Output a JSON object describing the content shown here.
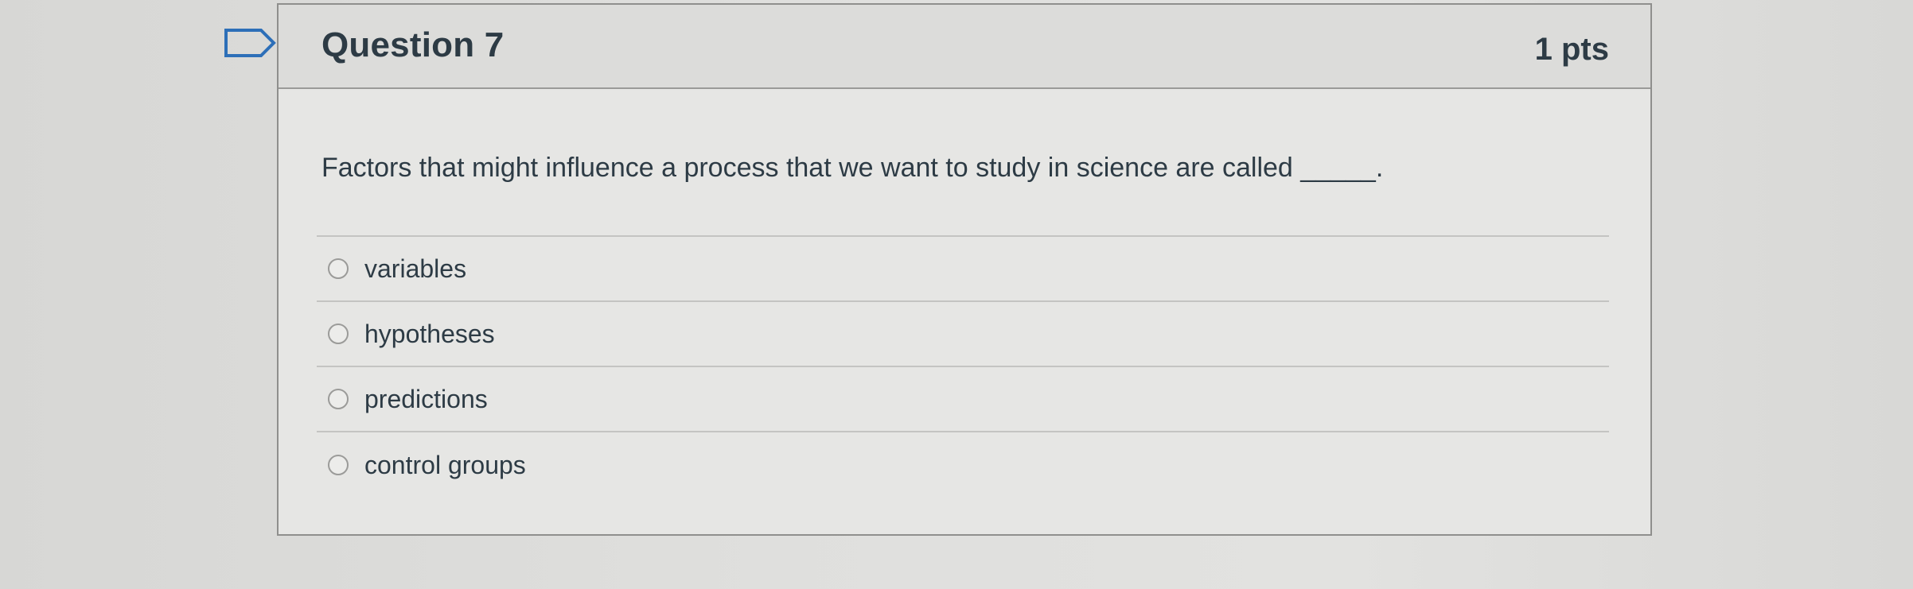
{
  "question": {
    "title": "Question 7",
    "points": "1 pts",
    "text": "Factors that might influence a process that we want to study in science are called _____.",
    "flag_icon": "flag-outline-icon"
  },
  "answers": [
    {
      "label": "variables",
      "selected": false
    },
    {
      "label": "hypotheses",
      "selected": false
    },
    {
      "label": "predictions",
      "selected": false
    },
    {
      "label": "control groups",
      "selected": false
    }
  ],
  "colors": {
    "text": "#2d3b45",
    "header_bg": "#dcdcda",
    "border": "#8f8f8d"
  }
}
